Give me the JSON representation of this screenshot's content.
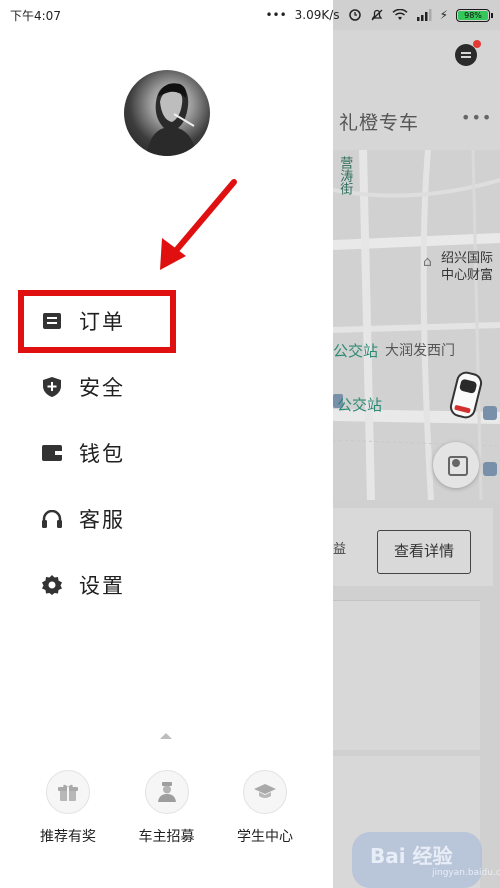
{
  "status_bar": {
    "time": "下午4:07",
    "network_speed": "3.09K/s",
    "battery": "98%"
  },
  "background": {
    "title": "礼橙专车",
    "map_labels": {
      "vertical": "营涛街",
      "poi": "绍兴国际中心财富",
      "bus_stop_1": "公交站",
      "road": "大润发西门",
      "bus_stop_2": "公交站"
    },
    "card_partial": "益",
    "view_detail": "查看详情"
  },
  "drawer": {
    "menu": [
      {
        "label": "订单",
        "icon": "order-icon"
      },
      {
        "label": "安全",
        "icon": "shield-icon"
      },
      {
        "label": "钱包",
        "icon": "wallet-icon"
      },
      {
        "label": "客服",
        "icon": "headset-icon"
      },
      {
        "label": "设置",
        "icon": "gear-icon"
      }
    ],
    "bottom": [
      {
        "label": "推荐有奖",
        "icon": "gift-icon"
      },
      {
        "label": "车主招募",
        "icon": "driver-icon"
      },
      {
        "label": "学生中心",
        "icon": "graduation-cap-icon"
      }
    ]
  },
  "annotation": {
    "color": "#e01010"
  },
  "watermark": {
    "text": "Bai 经验",
    "sub": "jingyan.baidu.com"
  },
  "colors": {
    "accent_red": "#e01010",
    "battery_green": "#34c759"
  }
}
